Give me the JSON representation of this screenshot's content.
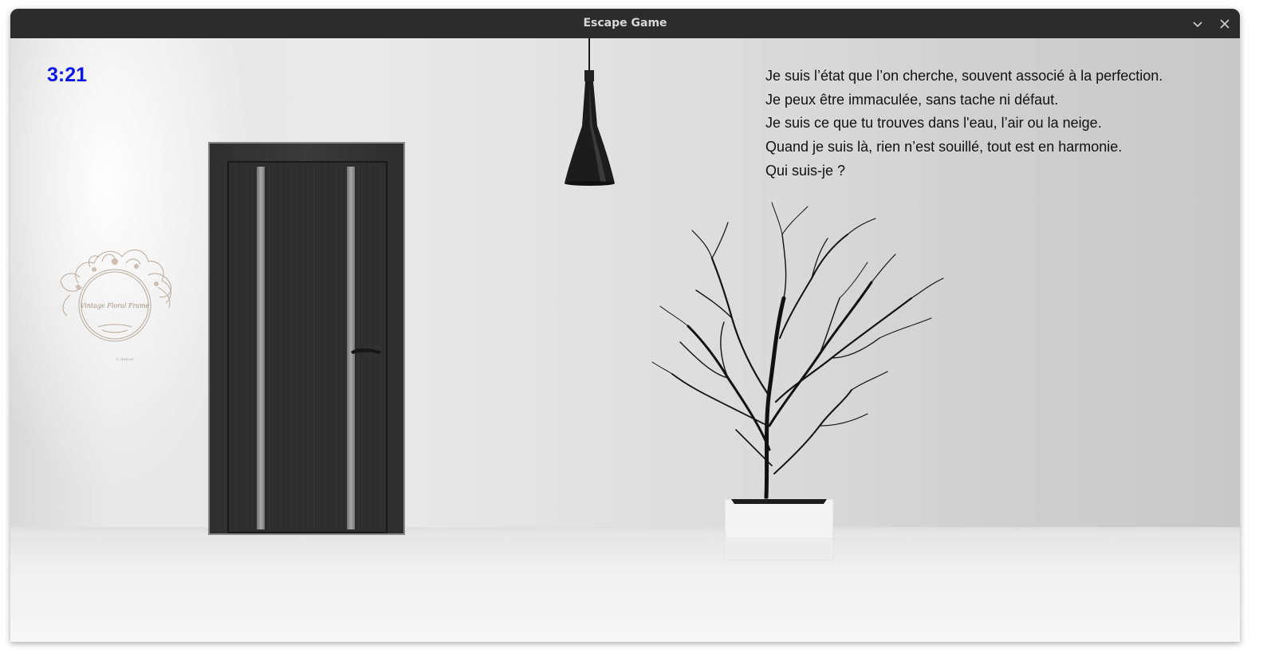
{
  "window": {
    "title": "Escape Game"
  },
  "game": {
    "timer": "3:21",
    "riddle_lines": [
      "Je suis l’état que l’on cherche, souvent associé à la perfection.",
      "Je peux être immaculée, sans tache ni défaut.",
      "Je suis ce que tu trouves dans l'eau, l’air ou la neige.",
      "Quand je suis là, rien n’est souillé, tout est en harmonie.",
      "Qui suis-je ?"
    ],
    "frame_text": "Vintage Floral Frame",
    "frame_credit": "© rawpixel",
    "timer_color": "#0a14e6"
  },
  "icons": {
    "minimize": "chevron-down-icon",
    "close": "close-icon"
  }
}
